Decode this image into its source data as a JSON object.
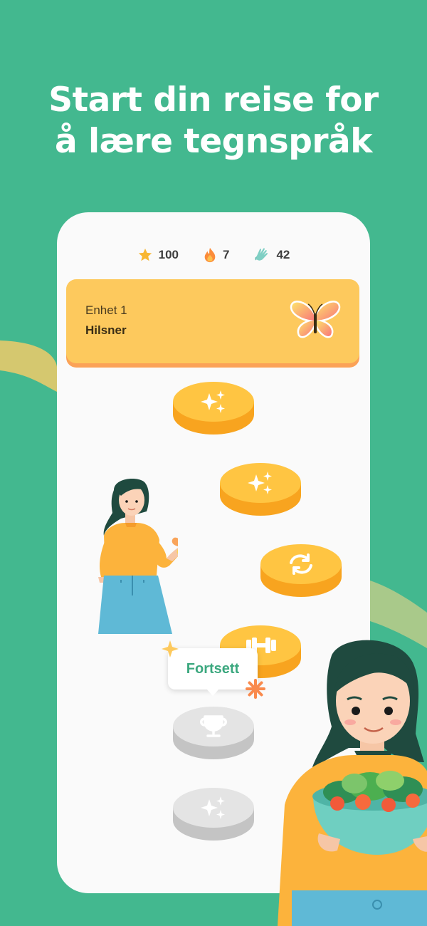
{
  "headline": {
    "line1": "Start din reise for",
    "line2": "å lære tegnspråk"
  },
  "colors": {
    "background": "#43b88f",
    "accent_yellow": "#fdc95d",
    "accent_orange": "#fba257",
    "coin_top": "#ffc542",
    "coin_side": "#f8a41f",
    "locked_top": "#e4e4e4",
    "locked_side": "#c4c4c4",
    "tooltip_text": "#3ca87f"
  },
  "stats": [
    {
      "icon": "star-icon",
      "value": "100"
    },
    {
      "icon": "flame-icon",
      "value": "7"
    },
    {
      "icon": "hand-icon",
      "value": "42"
    }
  ],
  "unit": {
    "number_label": "Enhet 1",
    "name": "Hilsner",
    "icon": "butterfly-icon"
  },
  "path_nodes": [
    {
      "icon": "sparkles-icon",
      "state": "completed"
    },
    {
      "icon": "sparkles-icon",
      "state": "completed"
    },
    {
      "icon": "refresh-icon",
      "state": "completed"
    },
    {
      "icon": "dumbbell-icon",
      "state": "current"
    },
    {
      "icon": "trophy-icon",
      "state": "locked"
    },
    {
      "icon": "sparkles-icon",
      "state": "locked"
    }
  ],
  "tooltip": {
    "label": "Fortsett"
  }
}
